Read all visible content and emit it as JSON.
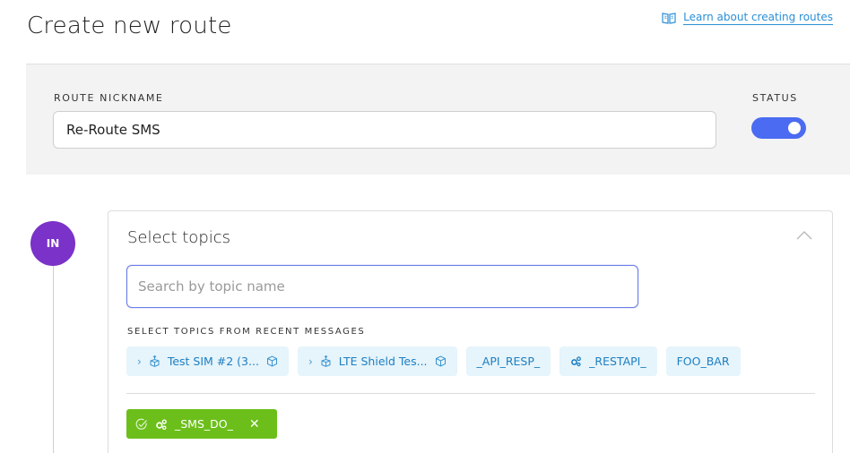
{
  "header": {
    "title": "Create new route",
    "learn_link": "Learn about creating routes"
  },
  "nickname_panel": {
    "nickname_label": "ROUTE NICKNAME",
    "nickname_value": "Re-Route SMS",
    "status_label": "STATUS",
    "status_on": true
  },
  "timeline": {
    "badge": "IN"
  },
  "topics": {
    "title": "Select topics",
    "search_placeholder": "Search by topic name",
    "recent_label": "SELECT TOPICS FROM RECENT MESSAGES",
    "recent_chips": [
      {
        "label": "Test SIM #2 (3...",
        "icon": "device-icon"
      },
      {
        "label": "LTE Shield Tes...",
        "icon": "device-icon"
      },
      {
        "label": "_API_RESP_"
      },
      {
        "label": "_RESTAPI_",
        "icon": "gears-icon"
      },
      {
        "label": "FOO_BAR"
      }
    ],
    "selected_chip": {
      "label": "_SMS_DO_"
    }
  },
  "colors": {
    "accent": "#4a6bf2",
    "badge": "#7a32c8",
    "chip_bg": "#e6f4fb",
    "chip_text": "#1d7fc2",
    "selected": "#6cbf1b"
  }
}
